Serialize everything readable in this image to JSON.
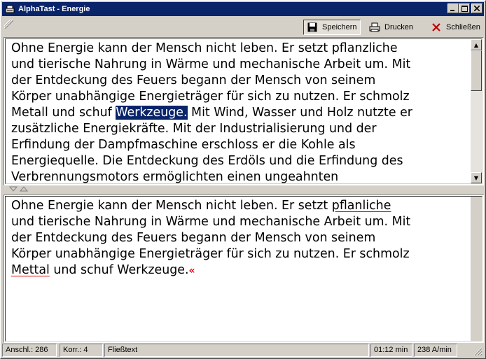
{
  "window": {
    "title": "AlphaTast - Energie",
    "controls": [
      "minimize-icon",
      "maximize-icon",
      "close-icon"
    ]
  },
  "toolbar": {
    "save_label": "Speichern",
    "print_label": "Drucken",
    "close_label": "Schließen"
  },
  "source_pane": {
    "lines": [
      "Ohne Energie kann der Mensch nicht leben. Er setzt pflanzliche",
      "und tierische Nahrung in Wärme und mechanische Arbeit um. Mit",
      "der Entdeckung des Feuers begann der Mensch von seinem",
      "Körper unabhängige Energieträger für sich zu nutzen. Er schmolz",
      "Metall und schuf ",
      "Werkzeuge.",
      " Mit Wind, Wasser und Holz nutzte er",
      "zusätzliche Energiekräfte. Mit der Industrialisierung und der",
      "Erfindung der Dampfmaschine erschloss er die Kohle als",
      "Energiequelle. Die Entdeckung des Erdöls und die Erfindung des",
      "Verbrennungsmotors ermöglichten einen ungeahnten"
    ],
    "highlighted_word": "Werkzeuge."
  },
  "typed_pane": {
    "line1_a": "Ohne Energie kann der Mensch nicht leben. Er setzt ",
    "line1_err": "pflanliche",
    "line2": "und tierische Nahrung in Wärme und mechanische Arbeit um. Mit",
    "line3": "der Entdeckung des Feuers begann der Mensch von seinem",
    "line4": "Körper unabhängige Energieträger für sich zu nutzen. Er schmolz",
    "line5_err": "Mettal",
    "line5_b": " und schuf Werkzeuge.",
    "cursor_mark": "«"
  },
  "statusbar": {
    "anschlaege": "Anschl.: 286",
    "korrekturen": "Korr.: 4",
    "mode": "Fließtext",
    "time": "01:12 min",
    "speed": "238 A/min"
  },
  "colors": {
    "titlebar": "#0a246a",
    "highlight": "#0a246a",
    "error": "#e00000",
    "chrome": "#d4d0c8"
  },
  "source_scroll_position": 0.05
}
